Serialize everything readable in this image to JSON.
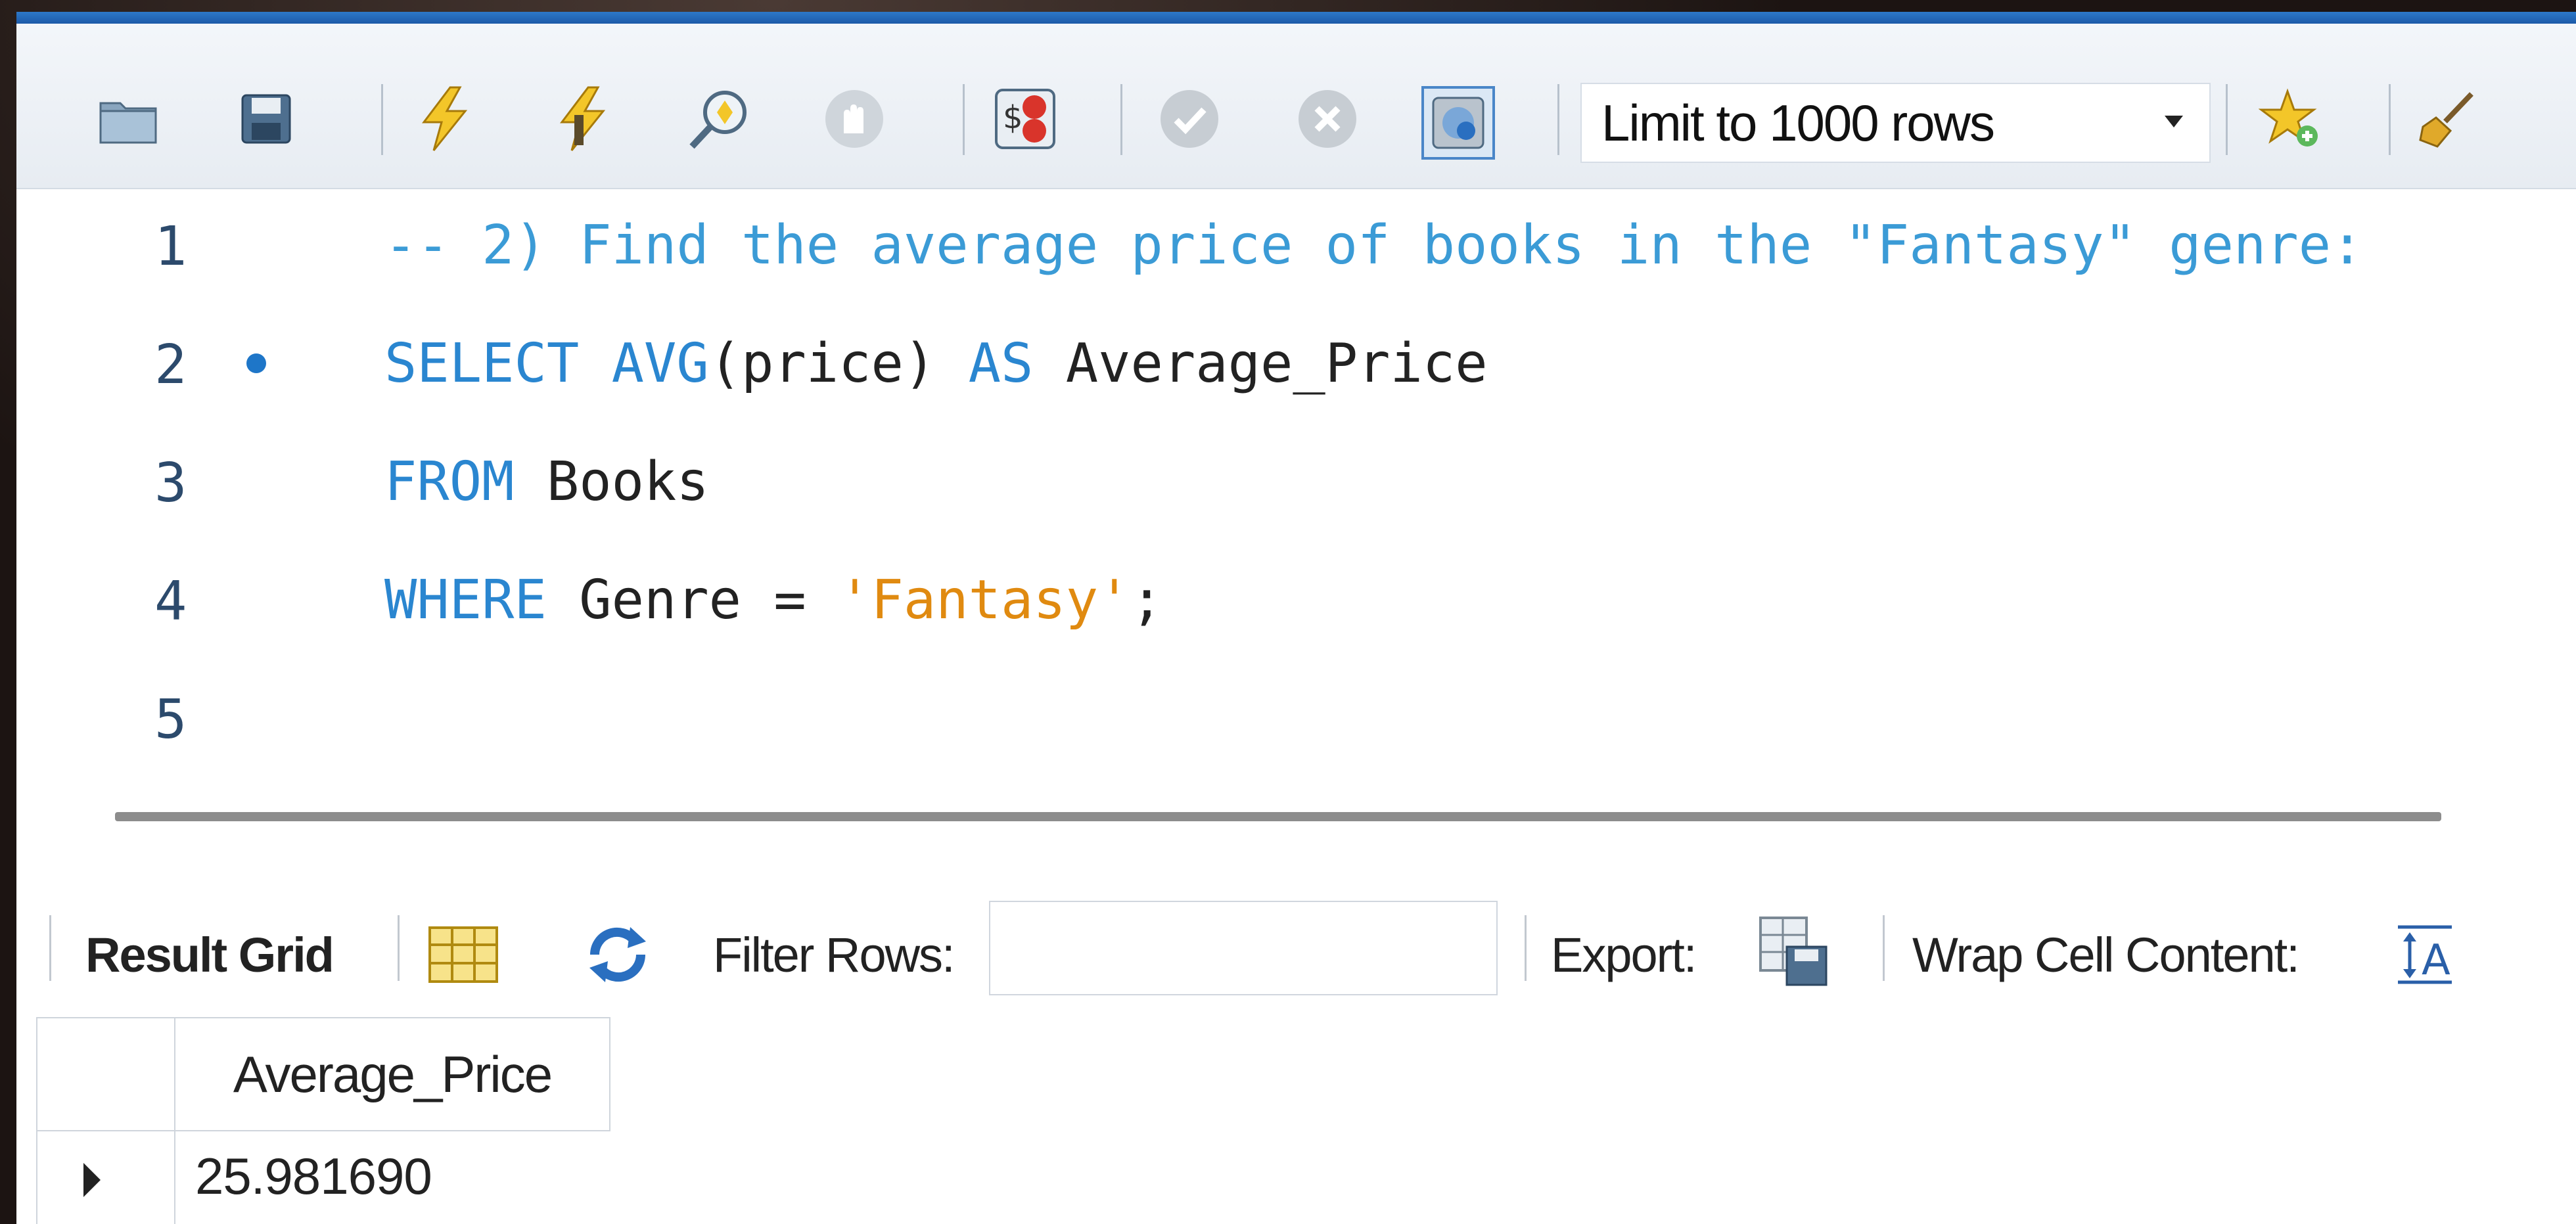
{
  "toolbar": {
    "limit_select_value": "Limit to 1000 rows",
    "icons": [
      "open-folder-icon",
      "save-icon",
      "execute-icon",
      "execute-current-icon",
      "explain-icon",
      "stop-icon",
      "toggle-errors-icon",
      "commit-icon",
      "rollback-icon",
      "auto-commit-icon",
      "add-snippet-icon",
      "beautify-icon"
    ]
  },
  "editor": {
    "lines": [
      {
        "num": "1",
        "comment": "-- 2) Find the average price of books in the \"Fantasy\" genre:"
      },
      {
        "num": "2",
        "kw1": "SELECT",
        "kw2": "AVG",
        "mid": "(price) ",
        "kw3": "AS",
        "rest": " Average_Price"
      },
      {
        "num": "3",
        "kw": "FROM",
        "rest": " Books"
      },
      {
        "num": "4",
        "kw": "WHERE",
        "mid": " Genre = ",
        "str": "'Fantasy'",
        "end": ";"
      },
      {
        "num": "5"
      }
    ]
  },
  "result_toolbar": {
    "result_grid_label": "Result Grid",
    "filter_rows_label": "Filter Rows:",
    "filter_rows_value": "",
    "export_label": "Export:",
    "wrap_cell_label": "Wrap Cell Content:"
  },
  "grid": {
    "columns": [
      "Average_Price"
    ],
    "rows": [
      [
        "25.981690"
      ]
    ]
  }
}
